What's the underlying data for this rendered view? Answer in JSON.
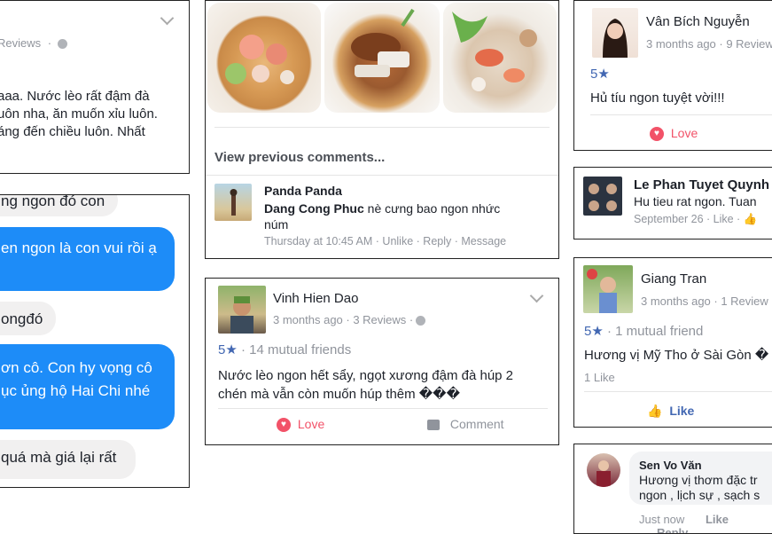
{
  "review_topleft": {
    "meta_tail": "Reviews",
    "text_lines": [
      "aaa. Nước lèo rất đậm đà",
      "uôn nha, ăn muốn xỉu luôn.",
      "áng đến chiều luôn. Nhất"
    ]
  },
  "chat": {
    "bubbles": [
      {
        "type": "gray",
        "text": "ng ngon đó con"
      },
      {
        "type": "blue",
        "text": "en ngon là con vui rồi ạ"
      },
      {
        "type": "gray",
        "text": "ongđó"
      },
      {
        "type": "blue",
        "lines": [
          "ơn cô. Con hy vọng cô",
          "ục ủng hộ Hai Chi nhé"
        ]
      },
      {
        "type": "gray",
        "text": "quá mà giá lại rất"
      }
    ]
  },
  "photo_post": {
    "view_previous": "View previous comments...",
    "commenter": "Panda Panda",
    "mention": "Dang Cong Phuc",
    "comment_rest_1": " nè cưng bao ngon nhức",
    "comment_rest_2": "núm",
    "time": "Thursday at 10:45 AM",
    "actions": [
      "Unlike",
      "Reply",
      "Message"
    ]
  },
  "review_vinh": {
    "name": "Vinh Hien Dao",
    "meta": "3 months ago · 3 Reviews ·",
    "rating": "5★",
    "mutual": "14 mutual friends",
    "text_lines": [
      "Nước lèo ngon hết sẩy, ngọt xương đậm đà húp 2",
      "chén mà vẫn còn muốn húp thêm ���"
    ],
    "love_label": "Love",
    "comment_label": "Comment"
  },
  "review_van": {
    "name": "Vân Bích Nguyễn",
    "meta": "3 months ago · 9 Review",
    "rating": "5★",
    "text": "Hủ tíu ngon tuyệt vời!!!",
    "love_label": "Love"
  },
  "review_le": {
    "name": "Le Phan Tuyet Quynh",
    "text": "Hu tieu rat ngon. Tuan",
    "meta": "September 26 · Like ·"
  },
  "review_giang": {
    "name": "Giang Tran",
    "meta": "3 months ago · 1 Review",
    "rating": "5★",
    "mutual": "1 mutual friend",
    "text": "Hương vị Mỹ Tho ở Sài Gòn �",
    "likes": "1 Like",
    "like_label": "Like"
  },
  "review_sen": {
    "name": "Sen Vo Văn",
    "text_lines": [
      "Hương vị thơm đặc tr",
      "ngon , lịch sự , sạch s"
    ],
    "time": "Just now",
    "like": "Like",
    "reply": "Reply"
  },
  "colors": {
    "fb_blue": "#4267b2",
    "messenger_blue": "#1d8cf8",
    "love_red": "#f25268"
  }
}
